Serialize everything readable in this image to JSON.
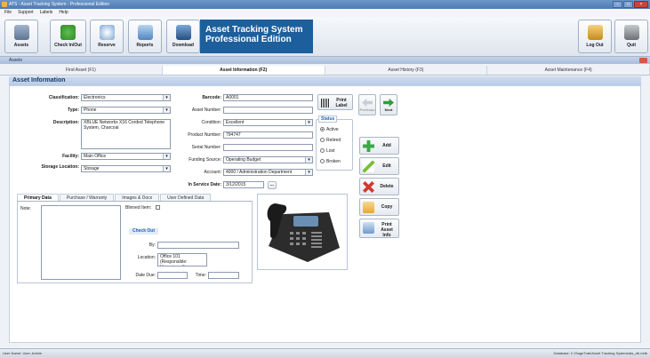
{
  "window": {
    "title": "ATS - Asset Tracking System - Professional Edition"
  },
  "menu": [
    "File",
    "Support",
    "Labels",
    "Help"
  ],
  "toolbar": {
    "buttons": [
      {
        "label": "Assets"
      },
      {
        "label": "Check In/Out"
      },
      {
        "label": "Reserve"
      },
      {
        "label": "Reports"
      },
      {
        "label": "Download"
      }
    ],
    "banner_line1": "Asset Tracking System",
    "banner_line2": "Professional Edition",
    "logout": "Log Out",
    "quit": "Quit"
  },
  "assets_bar": {
    "title": "Assets"
  },
  "tabs": [
    "Find Asset (F1)",
    "Asset Information (F2)",
    "Asset History (F3)",
    "Asset Maintenance (F4)"
  ],
  "section": {
    "title": "Asset Information"
  },
  "form": {
    "classification": {
      "label": "Classification:",
      "value": "Electronics"
    },
    "type": {
      "label": "Type:",
      "value": "Phone"
    },
    "description": {
      "label": "Description:",
      "value": "XBLUE Networks X16 Corded Telephone System, Charcoal"
    },
    "facility": {
      "label": "Facility:",
      "value": "Main Office"
    },
    "storage": {
      "label": "Storage Location:",
      "value": "Storage"
    },
    "barcode": {
      "label": "Barcode:",
      "value": "A0001"
    },
    "asset_number": {
      "label": "Asset Number:",
      "value": ""
    },
    "condition": {
      "label": "Condition:",
      "value": "Excellent"
    },
    "product_number": {
      "label": "Product Number:",
      "value": "794747"
    },
    "serial_number": {
      "label": "Serial Number:",
      "value": ""
    },
    "funding_source": {
      "label": "Funding Source:",
      "value": "Operating Budget"
    },
    "account": {
      "label": "Account:",
      "value": "4000 / Administration Department"
    },
    "in_service_date": {
      "label": "In Service Date:",
      "value": "3/12/2015"
    },
    "print_label": "Print Label",
    "date_btn": "...",
    "previous": "Previous",
    "next": "Next"
  },
  "status": {
    "title": "Status",
    "options": [
      "Active",
      "Retired",
      "Lost",
      "Broken"
    ],
    "selected": "Active"
  },
  "actions": [
    "Add",
    "Edit",
    "Delete",
    "Copy",
    "Print Asset Info"
  ],
  "subtabs": [
    "Primary Data",
    "Purchase / Warranty",
    "Images & Docs",
    "User Defined Data"
  ],
  "primary": {
    "note_label": "Note:",
    "blinned_label": "Blinned Item:",
    "checkout_title": "Check Out",
    "by_label": "By:",
    "location_label": "Location:",
    "location_value": "Office 101 (Responsible: Unassigned)",
    "date_due_label": "Date Due:",
    "time_label": "Time:"
  },
  "statusbar": {
    "left": "User Name: User, Admin",
    "right": "Database: C:\\SageTrak\\Asset Tracking System\\ats_db.mdb"
  },
  "colors": {
    "banner": "#1d5f9c",
    "accent": "#2366b2"
  }
}
